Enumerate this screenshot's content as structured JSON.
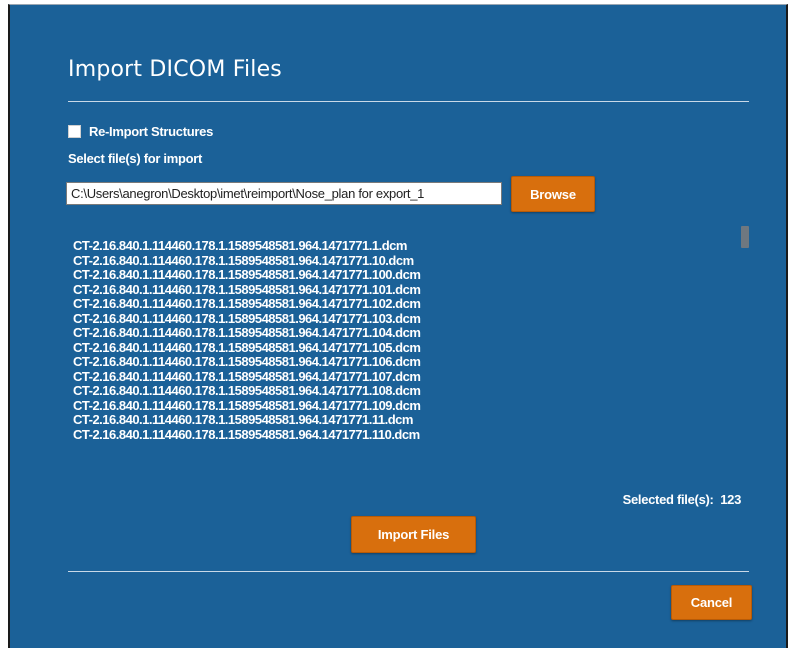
{
  "dialog": {
    "title": "Import DICOM Files"
  },
  "options": {
    "reimport_structures_label": "Re-Import Structures",
    "reimport_structures_checked": false,
    "select_files_label": "Select file(s) for import"
  },
  "path_input": {
    "value": "C:\\Users\\anegron\\Desktop\\imet\\reimport\\Nose_plan for export_1"
  },
  "buttons": {
    "browse": "Browse",
    "import_files": "Import Files",
    "cancel": "Cancel"
  },
  "file_list": [
    "CT-2.16.840.1.114460.178.1.1589548581.964.1471771.1.dcm",
    "CT-2.16.840.1.114460.178.1.1589548581.964.1471771.10.dcm",
    "CT-2.16.840.1.114460.178.1.1589548581.964.1471771.100.dcm",
    "CT-2.16.840.1.114460.178.1.1589548581.964.1471771.101.dcm",
    "CT-2.16.840.1.114460.178.1.1589548581.964.1471771.102.dcm",
    "CT-2.16.840.1.114460.178.1.1589548581.964.1471771.103.dcm",
    "CT-2.16.840.1.114460.178.1.1589548581.964.1471771.104.dcm",
    "CT-2.16.840.1.114460.178.1.1589548581.964.1471771.105.dcm",
    "CT-2.16.840.1.114460.178.1.1589548581.964.1471771.106.dcm",
    "CT-2.16.840.1.114460.178.1.1589548581.964.1471771.107.dcm",
    "CT-2.16.840.1.114460.178.1.1589548581.964.1471771.108.dcm",
    "CT-2.16.840.1.114460.178.1.1589548581.964.1471771.109.dcm",
    "CT-2.16.840.1.114460.178.1.1589548581.964.1471771.11.dcm",
    "CT-2.16.840.1.114460.178.1.1589548581.964.1471771.110.dcm"
  ],
  "selection": {
    "label": "Selected file(s):",
    "count": "123"
  },
  "colors": {
    "dialog_background": "#1b6198",
    "button_accent": "#d86f0d",
    "text": "#ffffff"
  }
}
